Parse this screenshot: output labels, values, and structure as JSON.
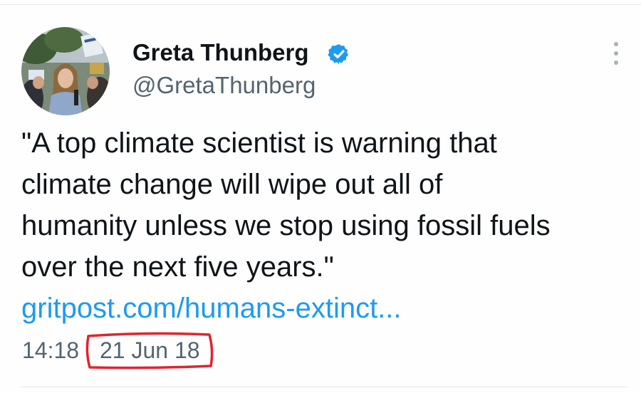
{
  "tweet": {
    "author": {
      "name": "Greta Thunberg",
      "handle": "@GretaThunberg",
      "avatar_icon": "profile-photo",
      "verified_icon": "verified-badge-icon"
    },
    "text": "\"A top climate scientist is warning that\nclimate change will wipe out all of\nhumanity unless we stop using fossil fuels\nover the next five years.\"",
    "link": "gritpost.com/humans-extinct...",
    "time": "14:18",
    "date": "21 Jun 18",
    "menu_icon": "more-options-icon"
  },
  "colors": {
    "text": "#0f1419",
    "secondary": "#536471",
    "link": "#1d9bf0",
    "verified": "#1d9bf0",
    "highlight": "#e0242e"
  }
}
